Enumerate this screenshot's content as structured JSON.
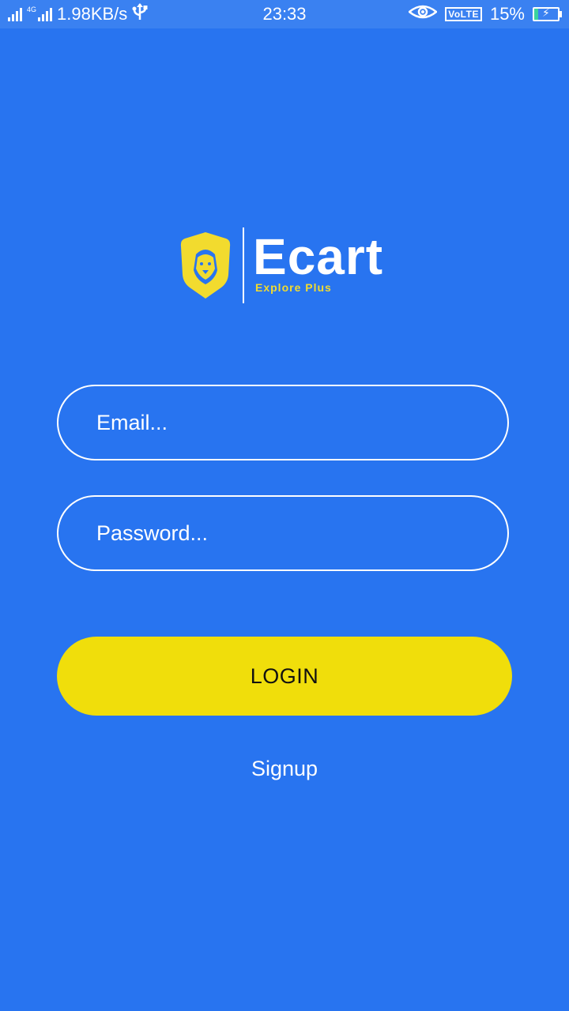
{
  "status_bar": {
    "network_type": "4G",
    "network_speed": "1.98KB/s",
    "time": "23:33",
    "volte": "VoLTE",
    "battery": "15%",
    "battery_level": 0.15,
    "icons": [
      "signal-icon",
      "usb-icon",
      "eye-icon",
      "battery-icon"
    ]
  },
  "logo": {
    "title": "Ecart",
    "subtitle": "Explore Plus",
    "icon": "lion-shield-icon",
    "colors": {
      "shield": "#F2DB2E",
      "title": "#FFFFFF",
      "subtitle": "#F2DB2E"
    }
  },
  "form": {
    "email_placeholder": "Email...",
    "email_value": "",
    "password_placeholder": "Password...",
    "password_value": "",
    "login_label": "LOGIN",
    "signup_label": "Signup"
  },
  "colors": {
    "background": "#2874F0",
    "status_bar": "#3A81F1",
    "login_button": "#F0DE0B",
    "login_text": "#111111"
  }
}
